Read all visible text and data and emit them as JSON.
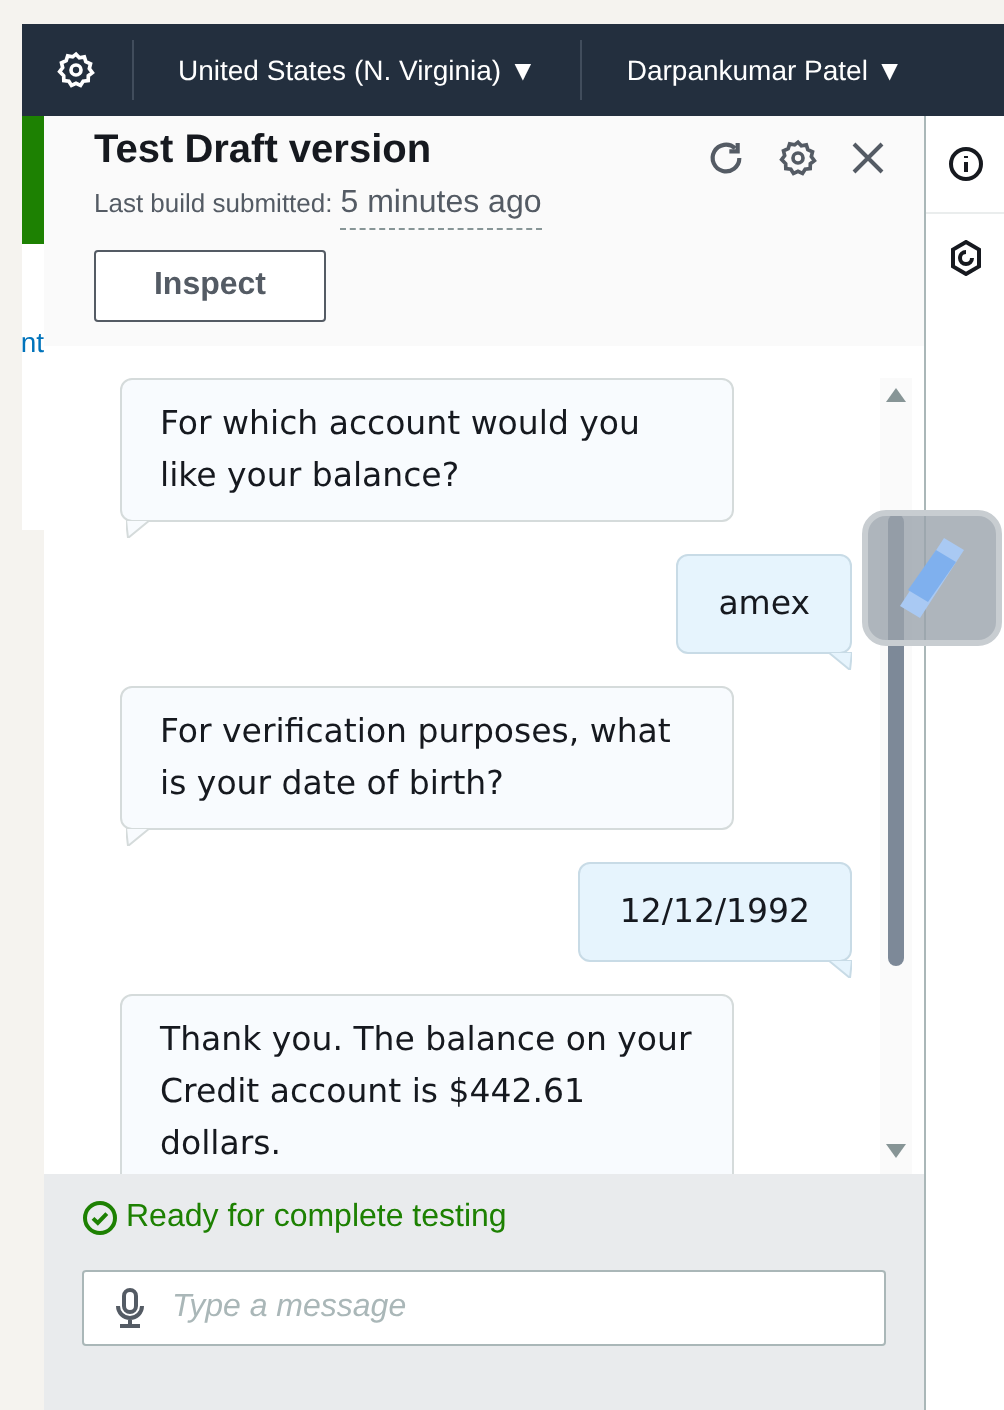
{
  "top_bar": {
    "region": "United States (N. Virginia) ▼",
    "user": "Darpankumar Patel ▼"
  },
  "left_fragment": "nt",
  "panel": {
    "title": "Test Draft version",
    "subtitle_label": "Last build submitted:",
    "subtitle_time": "5 minutes ago",
    "inspect_button": "Inspect"
  },
  "messages": [
    {
      "kind": "bot",
      "text": "For which account would you like your balance?"
    },
    {
      "kind": "user",
      "text": "amex"
    },
    {
      "kind": "bot",
      "text": "For verification purposes, what is your date of birth?"
    },
    {
      "kind": "user",
      "text": "12/12/1992"
    },
    {
      "kind": "bot",
      "text": "Thank you. The balance on your Credit account is $442.61 dollars."
    }
  ],
  "status": {
    "text": "Ready for complete testing",
    "kind": "success"
  },
  "input": {
    "placeholder": "Type a message"
  }
}
